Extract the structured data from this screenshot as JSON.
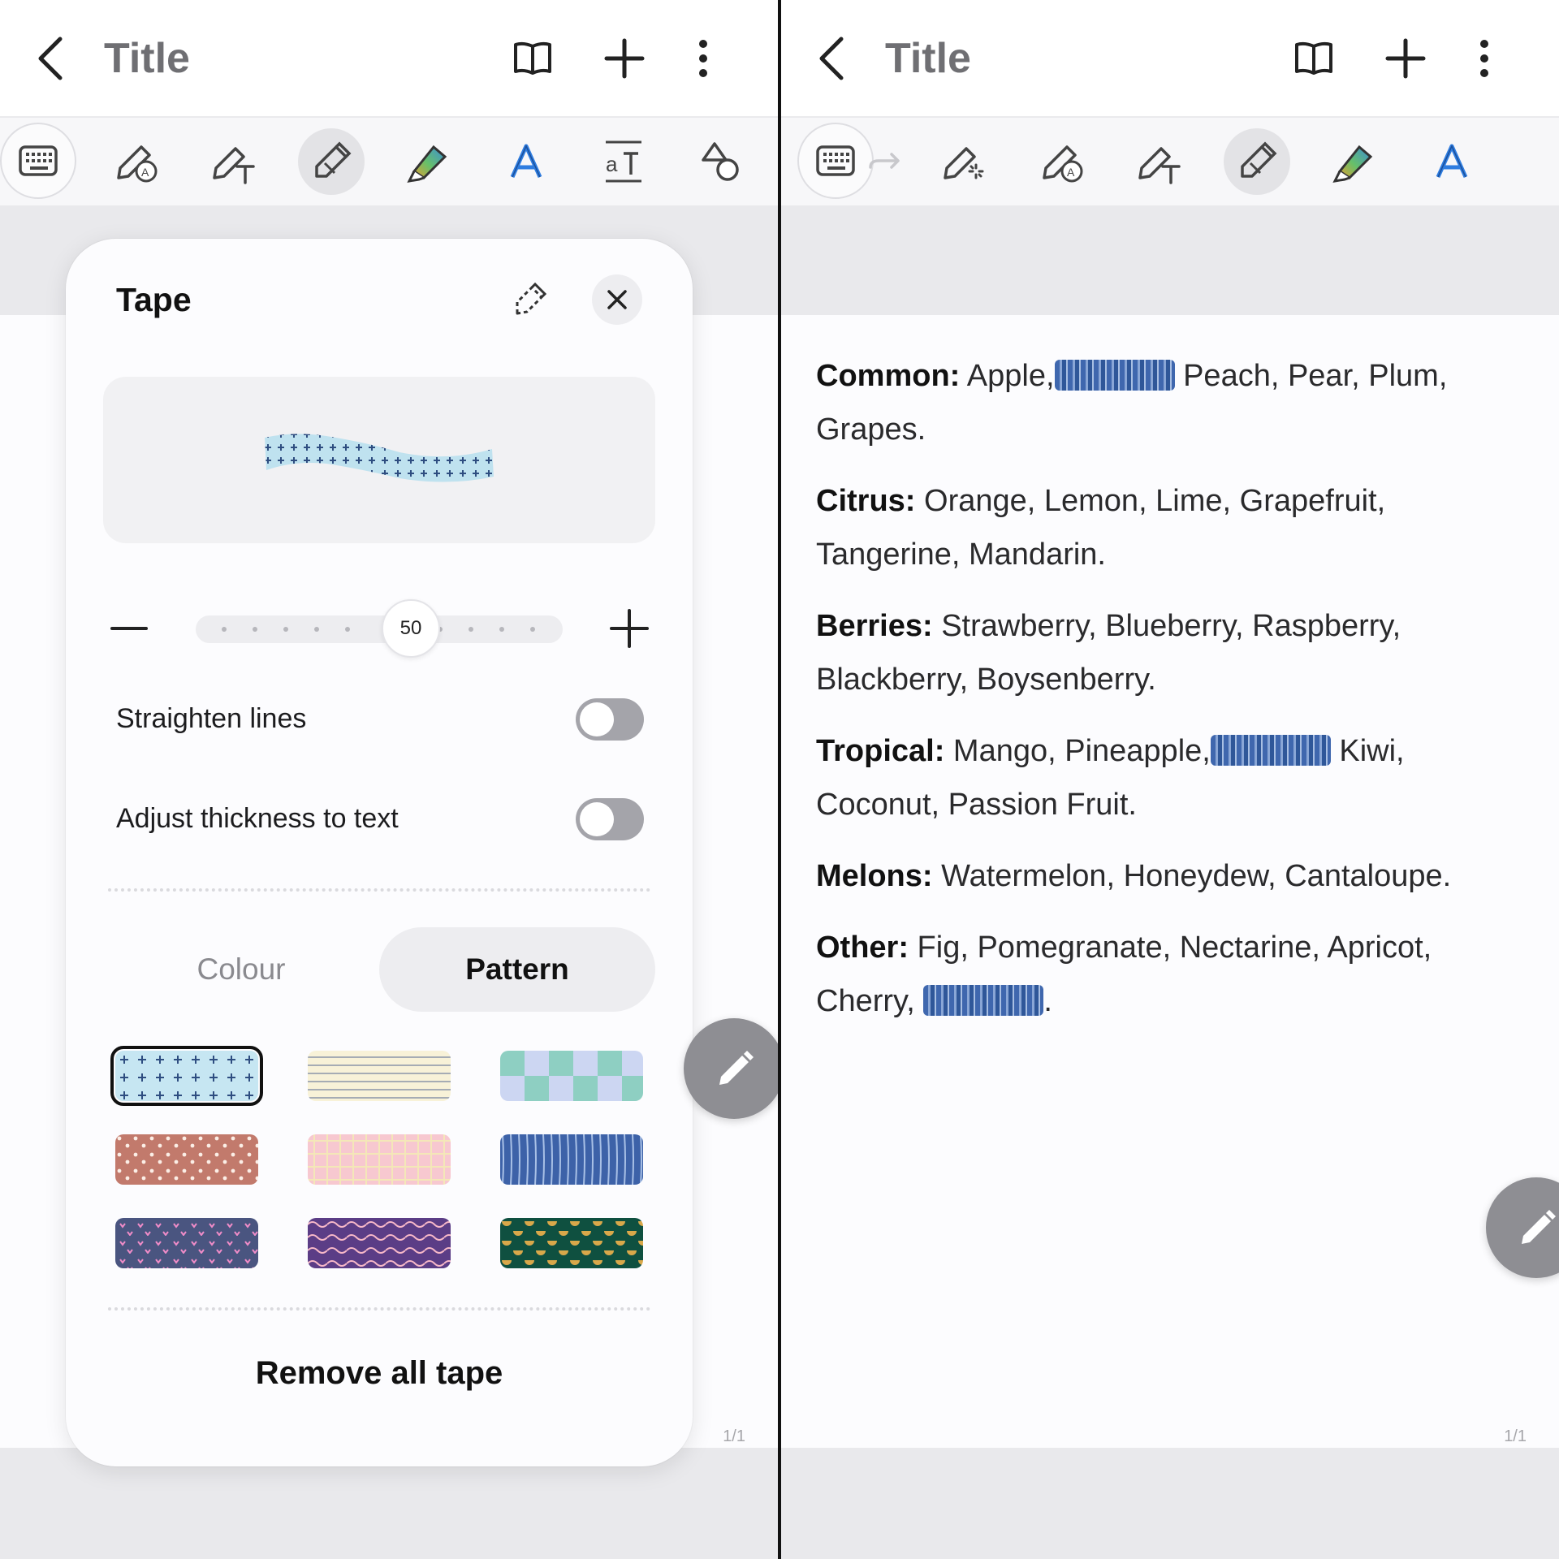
{
  "left": {
    "header": {
      "title": "Title"
    },
    "tape_panel": {
      "title": "Tape",
      "slider_value": "50",
      "options": [
        {
          "label": "Straighten lines",
          "on": false
        },
        {
          "label": "Adjust thickness to text",
          "on": false
        }
      ],
      "tabs": {
        "colour": "Colour",
        "pattern": "Pattern",
        "selected": "Pattern"
      },
      "patterns": [
        "blue-cross",
        "cream-lines",
        "teal-checker",
        "terracotta-dots",
        "pink-grid",
        "blue-stripes",
        "navy-hearts",
        "purple-waves",
        "green-mustard"
      ],
      "selected_pattern": "blue-cross",
      "remove_label": "Remove all tape"
    },
    "page_number": "1/1"
  },
  "right": {
    "header": {
      "title": "Title"
    },
    "note": [
      {
        "label": "Common:",
        "items": [
          " Apple,",
          "TAPE",
          " Peach, Pear, Plum, Grapes."
        ]
      },
      {
        "label": "Citrus:",
        "items": [
          " Orange, Lemon, Lime, Grapefruit, Tangerine, Mandarin."
        ]
      },
      {
        "label": "Berries:",
        "items": [
          " Strawberry, Blueberry, Raspberry, Blackberry, Boysenberry."
        ]
      },
      {
        "label": "Tropical:",
        "items": [
          " Mango, Pineapple,",
          "TAPE",
          " Kiwi, Coconut, Passion Fruit."
        ]
      },
      {
        "label": "Melons:",
        "items": [
          " Watermelon, Honeydew, Cantaloupe."
        ]
      },
      {
        "label": "Other:",
        "items": [
          " Fig, Pomegranate, Nectarine, Apricot, Cherry, ",
          "TAPE",
          "."
        ]
      }
    ],
    "page_number": "1/1"
  },
  "colors": {
    "tape_blue": "#3f67ae",
    "fab": "#8e8e93",
    "title_gray": "#6f6f73"
  }
}
